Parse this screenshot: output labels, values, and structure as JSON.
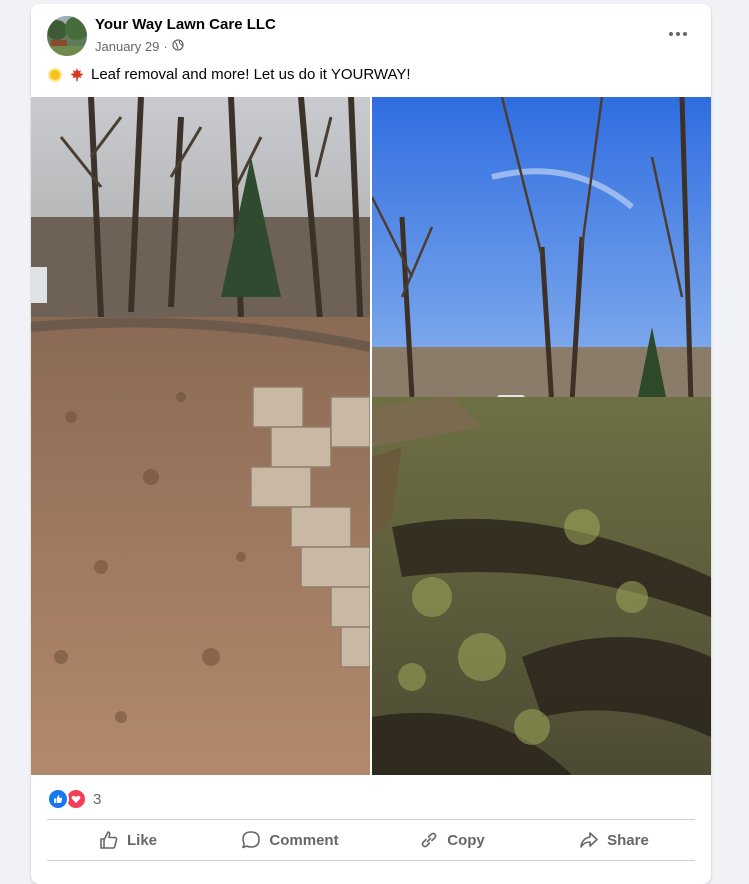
{
  "post": {
    "page_name": "Your Way Lawn Care LLC",
    "date": "January 29",
    "separator": "·",
    "audience_icon": "globe-icon",
    "caption_emojis": [
      "sun-emoji",
      "maple-leaf-emoji"
    ],
    "caption": "Leaf removal and more!  Let us do it YOURWAY!",
    "photos": [
      {
        "description_icon": "before-photo"
      },
      {
        "description_icon": "after-photo"
      }
    ]
  },
  "reactions": {
    "icons": [
      "like-icon",
      "love-icon"
    ],
    "count": "3"
  },
  "actions": {
    "like": "Like",
    "comment": "Comment",
    "copy": "Copy",
    "share": "Share"
  },
  "colors": {
    "background": "#f0f2f5",
    "card": "#ffffff",
    "secondary_text": "#65676b",
    "like_blue": "#1877f2",
    "love_red": "#f33e58"
  }
}
